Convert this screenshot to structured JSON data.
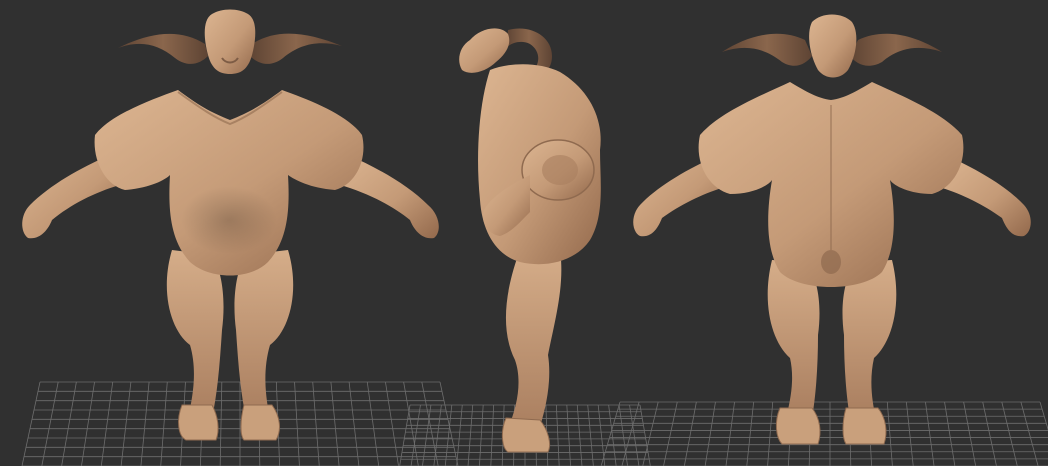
{
  "viewport": {
    "background": "#303030"
  },
  "grid": {
    "color": "#6d6d6d"
  },
  "model": {
    "skin": "#c49a77",
    "skin_light": "#d8b08c",
    "skin_shadow": "#8f6a4f",
    "horn": "#7d5c45",
    "horn_tip": "#5e4434",
    "views": [
      {
        "name": "front-view"
      },
      {
        "name": "side-view"
      },
      {
        "name": "back-view"
      }
    ]
  }
}
